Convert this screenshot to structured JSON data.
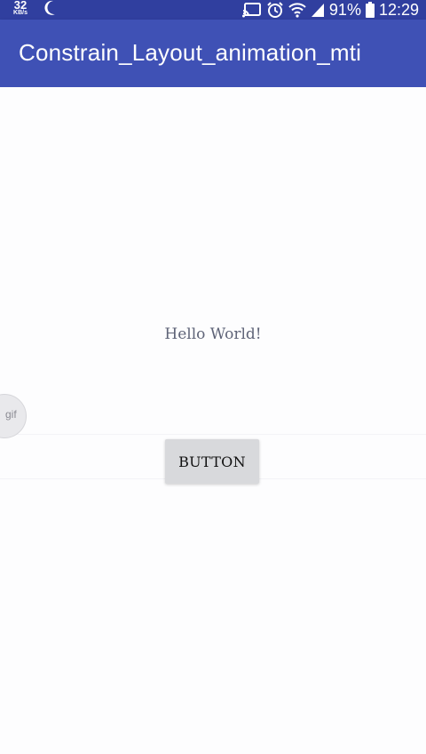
{
  "status_bar": {
    "net_speed_value": "32",
    "net_speed_unit": "KB/s",
    "battery_percent": "91%",
    "time": "12:29",
    "icons": [
      "moon-icon",
      "cast-icon",
      "alarm-icon",
      "wifi-icon",
      "signal-icon",
      "battery-icon"
    ],
    "color": "#303f9f"
  },
  "app_bar": {
    "title": "Constrain_Layout_animation_mti",
    "color": "#3f51b5"
  },
  "main": {
    "hello_text": "Hello World!",
    "button_label": "BUTTON"
  },
  "overlay": {
    "gif_label": "gif"
  }
}
